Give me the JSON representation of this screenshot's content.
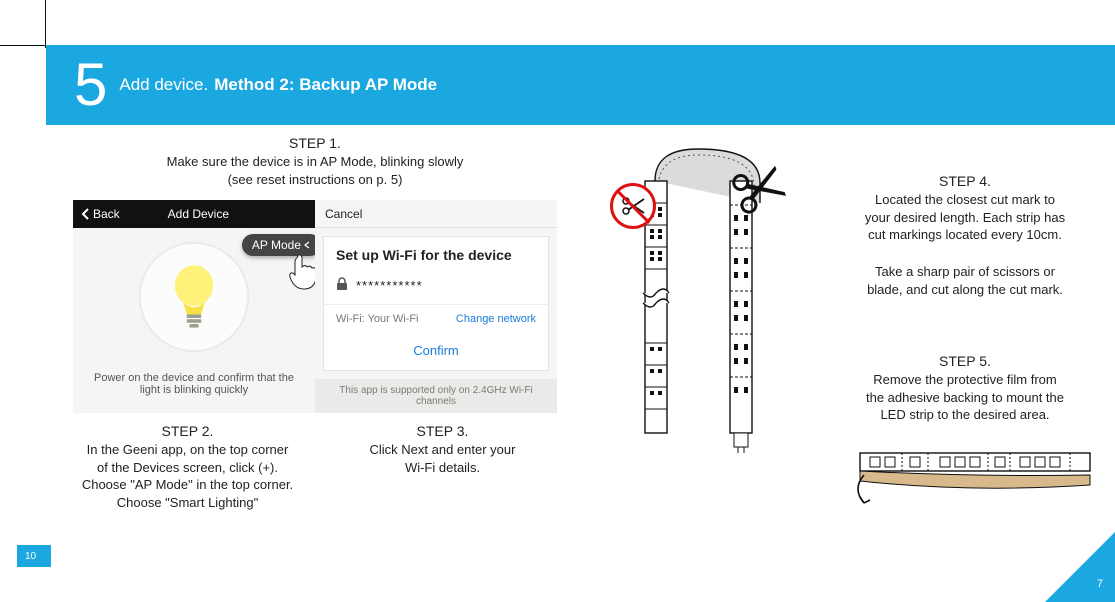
{
  "header": {
    "number": "5",
    "light": "Add device.",
    "bold": "Method 2: Backup AP Mode"
  },
  "step1": {
    "title": "STEP 1.",
    "line1": "Make sure the device is in AP Mode, blinking slowly",
    "line2": "(see reset instructions on p. 5)"
  },
  "phoneA": {
    "back": "Back",
    "title": "Add Device",
    "apmode": "AP Mode",
    "msg": "Power on the device and confirm that the light is blinking quickly"
  },
  "phoneB": {
    "cancel": "Cancel",
    "title": "Set up Wi-Fi for the device",
    "password": "***********",
    "wifiLabel": "Wi-Fi: Your Wi-Fi",
    "change": "Change network",
    "confirm": "Confirm",
    "note": "This app is supported only on 2.4GHz Wi-Fi channels"
  },
  "step2": {
    "title": "STEP 2.",
    "l1": "In the Geeni app, on the top corner",
    "l2": "of the Devices screen, click (+).",
    "l3": "Choose \"AP Mode\" in the top corner.",
    "l4": "Choose \"Smart Lighting\""
  },
  "step3": {
    "title": "STEP 3.",
    "l1": "Click Next and enter your",
    "l2": "Wi-Fi details."
  },
  "step4": {
    "title": "STEP 4.",
    "l1": "Located the closest cut mark to",
    "l2": "your desired length. Each strip has",
    "l3": "cut markings located every 10cm."
  },
  "step4b": {
    "l1": "Take a sharp pair of scissors or",
    "l2": "blade, and cut along the cut mark."
  },
  "step5": {
    "title": "STEP 5.",
    "l1": "Remove the protective film from",
    "l2": "the adhesive backing to mount the",
    "l3": "LED strip to the desired area."
  },
  "pages": {
    "left": "10",
    "right": "7"
  }
}
